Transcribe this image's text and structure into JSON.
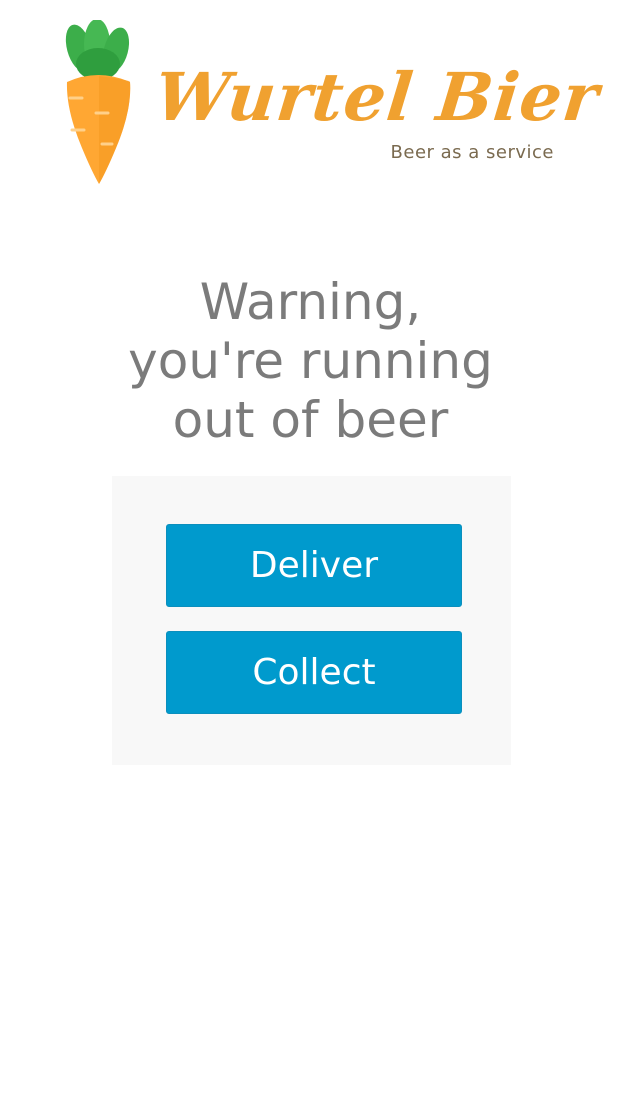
{
  "header": {
    "brand_name": "Wurtel Bier",
    "tagline": "Beer as a service",
    "logo_icon": "carrot-icon",
    "brand_color": "#f0a130"
  },
  "main": {
    "warning_lines": [
      "Warning,",
      "you're running",
      "out of beer"
    ],
    "actions": {
      "deliver_label": "Deliver",
      "collect_label": "Collect"
    },
    "button_color": "#009acd"
  }
}
